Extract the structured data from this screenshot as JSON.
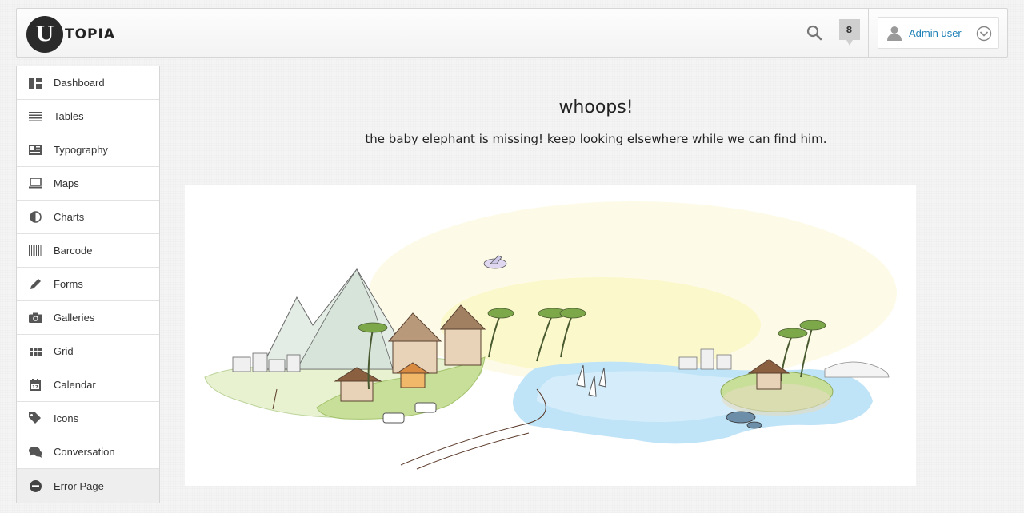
{
  "header": {
    "logo_letter": "U",
    "logo_text": "TOPIA",
    "notifications_count": "8",
    "user_name": "Admin user"
  },
  "sidebar": {
    "items": [
      {
        "label": "Dashboard",
        "icon": "dashboard-icon"
      },
      {
        "label": "Tables",
        "icon": "tables-icon"
      },
      {
        "label": "Typography",
        "icon": "typography-icon"
      },
      {
        "label": "Maps",
        "icon": "laptop-icon"
      },
      {
        "label": "Charts",
        "icon": "pie-chart-icon"
      },
      {
        "label": "Barcode",
        "icon": "barcode-icon"
      },
      {
        "label": "Forms",
        "icon": "pencil-icon"
      },
      {
        "label": "Galleries",
        "icon": "camera-icon"
      },
      {
        "label": "Grid",
        "icon": "grid-icon"
      },
      {
        "label": "Calendar",
        "icon": "calendar-icon"
      },
      {
        "label": "Icons",
        "icon": "tag-icon"
      },
      {
        "label": "Conversation",
        "icon": "chat-icon"
      },
      {
        "label": "Error Page",
        "icon": "minus-circle-icon",
        "active": true
      }
    ]
  },
  "main": {
    "title": "whoops!",
    "message": "the baby elephant is missing! keep looking elsewhere while we can find him."
  },
  "colors": {
    "accent": "#1a7fb5",
    "water": "#bfe3f7",
    "grass": "#c8df9a",
    "sun": "#fdfbe0"
  }
}
